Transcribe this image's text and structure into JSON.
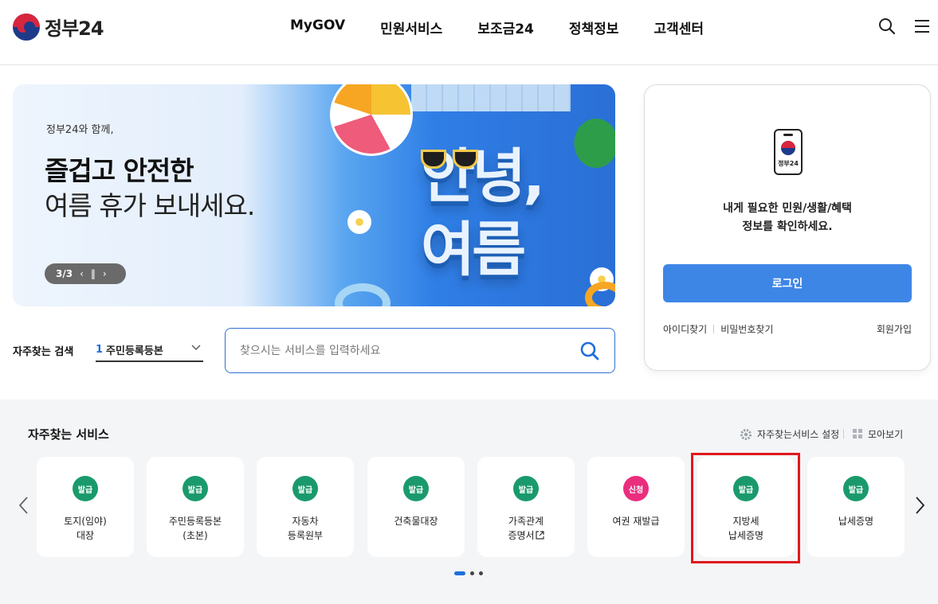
{
  "header": {
    "logo_text": "정부24",
    "nav": [
      "MyGOV",
      "민원서비스",
      "보조금24",
      "정책정보",
      "고객센터"
    ]
  },
  "banner": {
    "subtitle": "정부24와 함께,",
    "title_bold": "즐겁고 안전한",
    "title_regular": "여름 휴가 보내세요.",
    "art_text": "안녕, 여름",
    "pager": {
      "current": "3/3"
    }
  },
  "search": {
    "label": "자주찾는 검색",
    "rank": "1",
    "selected": "주민등록등본",
    "placeholder": "찾으시는 서비스를 입력하세요"
  },
  "login": {
    "phone_label": "정부24",
    "message_line1": "내게 필요한 민원/생활/혜택",
    "message_line2": "정보를 확인하세요.",
    "button": "로그인",
    "find_id": "아이디찾기",
    "find_pw": "비밀번호찾기",
    "join": "회원가입"
  },
  "services": {
    "title": "자주찾는 서비스",
    "setting_label": "자주찾는서비스 설정",
    "view_all_label": "모아보기",
    "items": [
      {
        "badge": "발급",
        "name": "토지(임야)\n대장",
        "badge_color": "#1a9a6c"
      },
      {
        "badge": "발급",
        "name": "주민등록등본\n(초본)",
        "badge_color": "#1a9a6c"
      },
      {
        "badge": "발급",
        "name": "자동차\n등록원부",
        "badge_color": "#1a9a6c"
      },
      {
        "badge": "발급",
        "name": "건축물대장",
        "badge_color": "#1a9a6c"
      },
      {
        "badge": "발급",
        "name": "가족관계\n증명서",
        "badge_color": "#1a9a6c",
        "external": true
      },
      {
        "badge": "신청",
        "name": "여권 재발급",
        "badge_color": "#ea2e7e"
      },
      {
        "badge": "발급",
        "name": "지방세\n납세증명",
        "badge_color": "#1a9a6c"
      },
      {
        "badge": "발급",
        "name": "납세증명",
        "badge_color": "#1a9a6c"
      }
    ],
    "page_count": 3,
    "active_page": 1
  },
  "colors": {
    "primary": "#3e86e6",
    "issue_badge": "#1a9a6c",
    "apply_badge": "#ea2e7e",
    "highlight": "#e0191d"
  },
  "icons": [
    "search-icon",
    "menu-icon",
    "chevron-down-icon",
    "gear-icon",
    "grid-icon",
    "chevron-left-icon",
    "chevron-right-icon",
    "external-link-icon",
    "pause-icon"
  ]
}
